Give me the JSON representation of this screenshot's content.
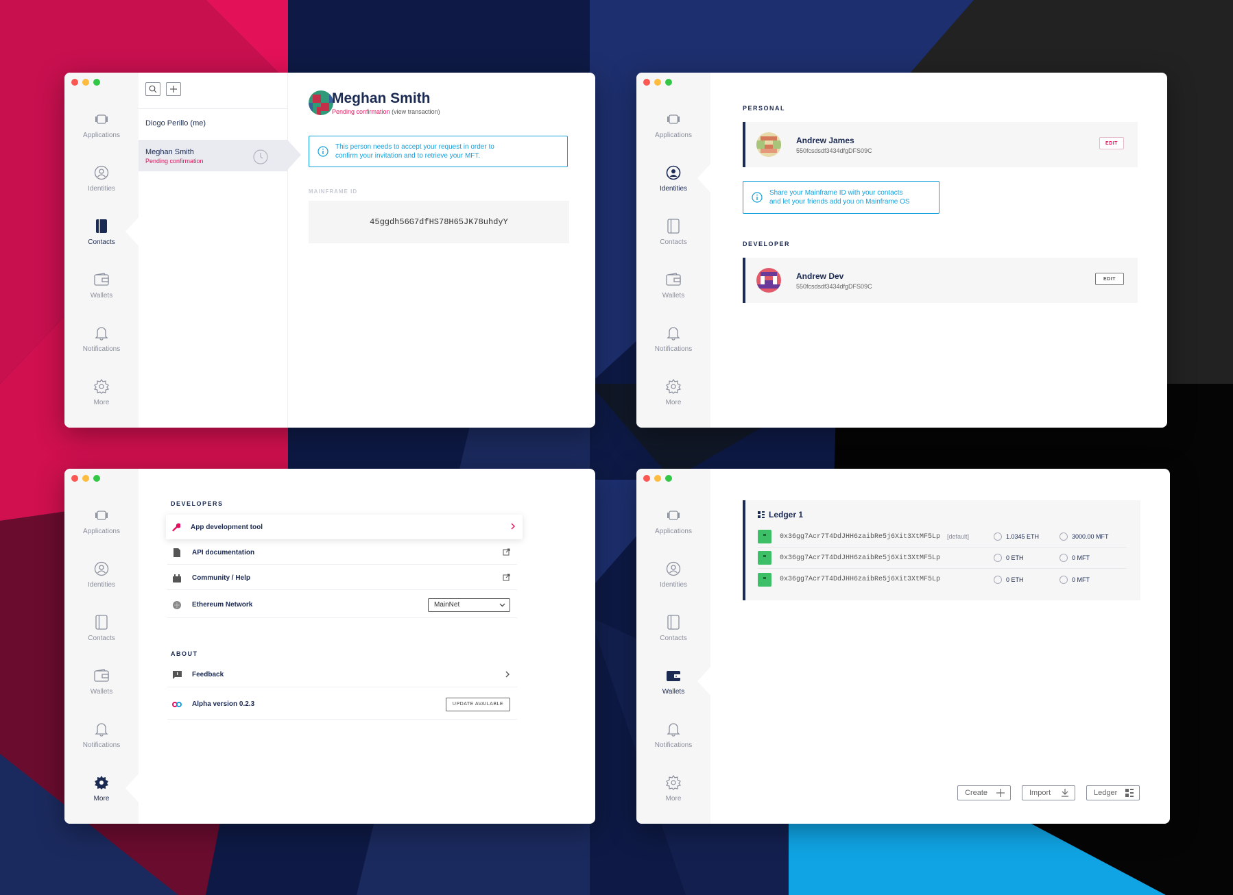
{
  "colors": {
    "accent_navy": "#1b2a52",
    "accent_pink": "#e3105e",
    "info_blue": "#11a0dc",
    "wallet_green": "#3cbf66"
  },
  "nav": [
    {
      "label": "Applications",
      "icon": "applications-icon"
    },
    {
      "label": "Identities",
      "icon": "identity-icon"
    },
    {
      "label": "Contacts",
      "icon": "contacts-icon"
    },
    {
      "label": "Wallets",
      "icon": "wallet-icon"
    },
    {
      "label": "Notifications",
      "icon": "bell-icon"
    },
    {
      "label": "More",
      "icon": "gear-icon"
    }
  ],
  "contacts_window": {
    "list": [
      {
        "name": "Diogo Perillo (me)",
        "status": ""
      },
      {
        "name": "Meghan Smith",
        "status": "Pending confirmation"
      }
    ],
    "detail": {
      "name": "Meghan Smith",
      "status": "Pending confirmation",
      "view_link": "(view transaction)",
      "info_line1": "This person needs to accept your request in order to",
      "info_line2": "confirm your invitation and to retrieve your MFT.",
      "mainframe_id_label": "MAINFRAME ID",
      "mainframe_id": "45ggdh56G7dfHS78H65JK78uhdyY"
    }
  },
  "identities_window": {
    "personal_title": "PERSONAL",
    "personal": {
      "name": "Andrew James",
      "key": "550fcsdsdf3434dfgDFS09C",
      "edit_label": "EDIT"
    },
    "share_line1": "Share your Mainframe ID with your contacts",
    "share_line2": "and let your friends add you on Mainframe OS",
    "developer_title": "DEVELOPER",
    "developer": {
      "name": "Andrew Dev",
      "key": "550fcsdsdf3434dfgDFS09C",
      "edit_label": "EDIT"
    }
  },
  "more_window": {
    "developers_title": "DEVELOPERS",
    "developers": [
      {
        "label": "App development tool",
        "icon": "wrench-icon",
        "end": "chevron-right-icon"
      },
      {
        "label": "API documentation",
        "icon": "document-icon",
        "end": "external-link-icon"
      },
      {
        "label": "Community / Help",
        "icon": "community-icon",
        "end": "external-link-icon"
      },
      {
        "label": "Ethereum Network",
        "icon": "ethereum-icon",
        "end": "select"
      }
    ],
    "network_value": "MainNet",
    "about_title": "ABOUT",
    "about": [
      {
        "label": "Feedback",
        "icon": "feedback-icon",
        "end": "chevron-right-icon"
      },
      {
        "label": "Alpha version 0.2.3",
        "icon": "mainframe-logo-icon",
        "end": "update-button"
      }
    ],
    "update_label": "UPDATE AVAILABLE"
  },
  "wallets_window": {
    "ledger_title": "Ledger 1",
    "accounts": [
      {
        "address": "0x36gg7Acr7T4DdJHH6zaibRe5j6Xit3XtMF5Lp",
        "tag": "[default]",
        "eth": "1.0345 ETH",
        "mft": "3000.00 MFT"
      },
      {
        "address": "0x36gg7Acr7T4DdJHH6zaibRe5j6Xit3XtMF5Lp",
        "tag": "",
        "eth": "0 ETH",
        "mft": "0 MFT"
      },
      {
        "address": "0x36gg7Acr7T4DdJHH6zaibRe5j6Xit3XtMF5Lp",
        "tag": "",
        "eth": "0 ETH",
        "mft": "0 MFT"
      }
    ],
    "buttons": {
      "create": "Create",
      "import": "Import",
      "ledger": "Ledger"
    }
  }
}
